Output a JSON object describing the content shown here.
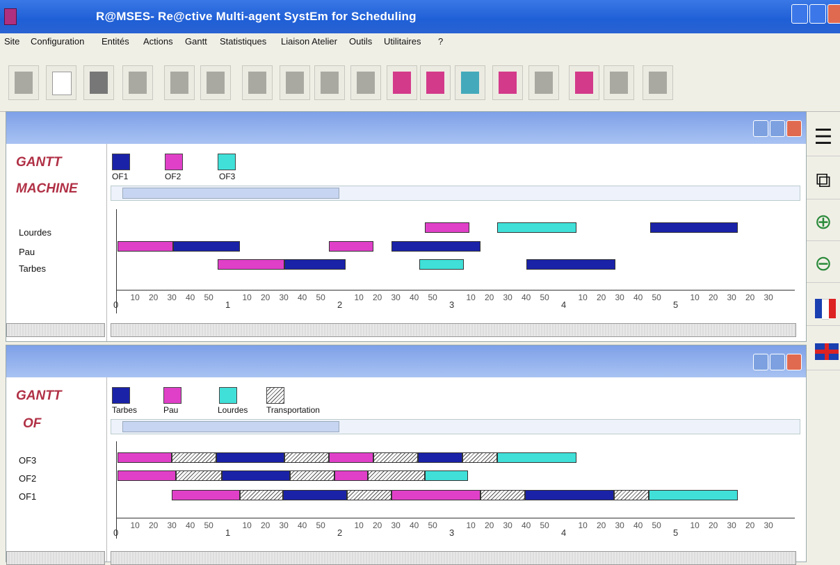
{
  "window": {
    "title": "R@MSES- Re@ctive Multi-agent SystEm for Scheduling"
  },
  "menu": [
    "Site",
    "Configuration",
    "Entités",
    "Actions",
    "Gantt",
    "Statistiques",
    "Liaison Atelier",
    "Outils",
    "Utilitaires",
    "?"
  ],
  "colors": {
    "OF1": "#1a22a8",
    "OF2": "#e040c8",
    "OF3": "#40e0d8",
    "Tarbes": "#1a22a8",
    "Pau": "#e040c8",
    "Lourdes": "#40e0d8"
  },
  "gantt_machine": {
    "label1": "GANTT",
    "label2": "MACHINE",
    "legend": [
      "OF1",
      "OF2",
      "OF3"
    ],
    "rows": [
      "Lourdes",
      "Pau",
      "Tarbes"
    ]
  },
  "gantt_of": {
    "label1": "GANTT",
    "label2": "OF",
    "legend": [
      "Tarbes",
      "Pau",
      "Lourdes",
      "Transportation"
    ],
    "rows": [
      "OF3",
      "OF2",
      "OF1"
    ]
  },
  "axis": {
    "zero": "0",
    "minor": [
      "10",
      "20",
      "30",
      "40",
      "50"
    ],
    "majors": [
      "1",
      "2",
      "3",
      "4",
      "5"
    ],
    "tail": [
      "10",
      "20",
      "30",
      "20",
      "30"
    ]
  },
  "right_tools": [
    "layout-icon",
    "copy-icon",
    "zoom-in-icon",
    "zoom-out-icon",
    "french-flag-icon",
    "uk-flag-icon"
  ]
}
